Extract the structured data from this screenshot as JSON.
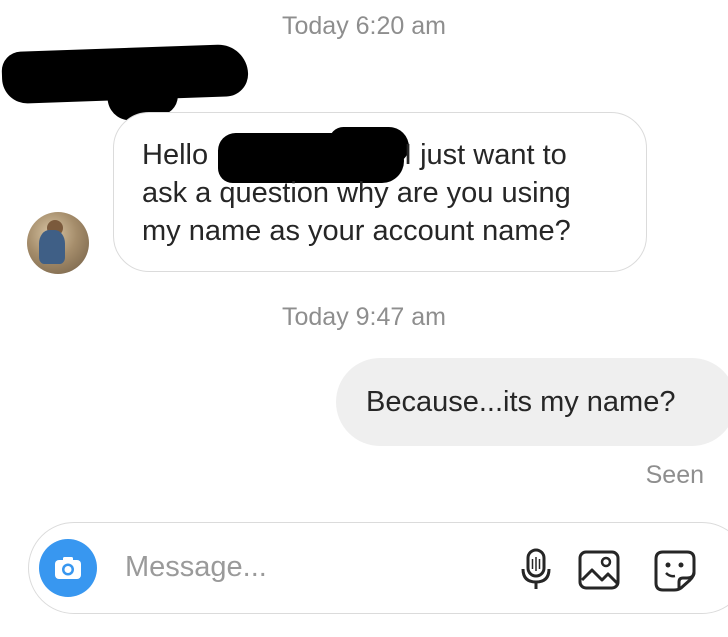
{
  "timestamps": [
    "Today 6:20 am",
    "Today 9:47 am"
  ],
  "incoming_message": {
    "line1_start": "Hello",
    "line1_end": "I just want to",
    "line2": "ask a question why are you using",
    "line3": "my name as your account name?"
  },
  "outgoing_message": "Because...its my name?",
  "seen_label": "Seen",
  "composer": {
    "placeholder": "Message...",
    "icons": [
      "camera-icon",
      "microphone-icon",
      "gallery-icon",
      "sticker-icon"
    ]
  },
  "colors": {
    "accent": "#3897f0",
    "outgoing_bubble": "#efefef",
    "timestamp_text": "#8e8e8e"
  }
}
